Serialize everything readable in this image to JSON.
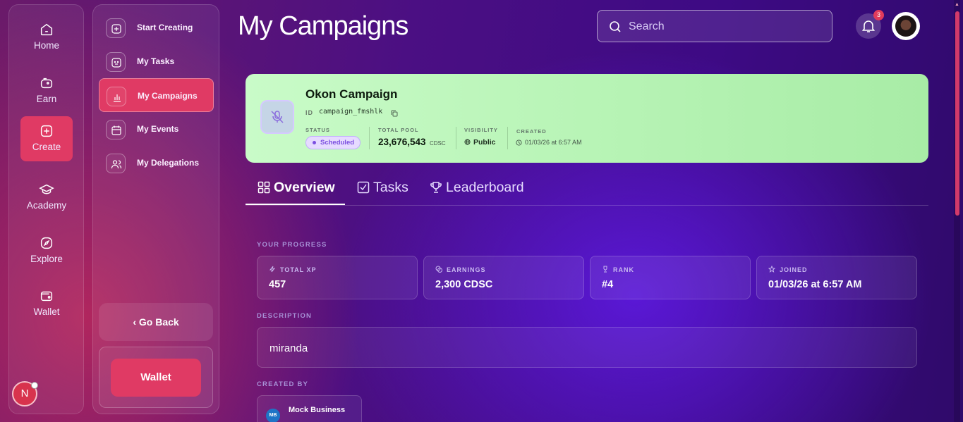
{
  "rail": {
    "items": [
      {
        "label": "Home",
        "icon": "home-icon"
      },
      {
        "label": "Earn",
        "icon": "piggy-bank-icon"
      },
      {
        "label": "Create",
        "icon": "plus-square-icon",
        "active": true
      },
      {
        "label": "Academy",
        "icon": "graduation-cap-icon"
      },
      {
        "label": "Explore",
        "icon": "compass-icon"
      },
      {
        "label": "Wallet",
        "icon": "wallet-icon"
      }
    ],
    "avatar_initial": "N"
  },
  "subnav": {
    "items": [
      {
        "label": "Start Creating",
        "icon": "plus-square-icon"
      },
      {
        "label": "My Tasks",
        "icon": "smiley-square-icon"
      },
      {
        "label": "My Campaigns",
        "icon": "bar-chart-icon",
        "active": true
      },
      {
        "label": "My Events",
        "icon": "calendar-icon"
      },
      {
        "label": "My Delegations",
        "icon": "users-icon"
      }
    ],
    "go_back": "Go Back",
    "wallet_button": "Wallet"
  },
  "header": {
    "title": "My Campaigns",
    "search_placeholder": "Search",
    "notification_count": "3"
  },
  "campaign": {
    "name": "Okon Campaign",
    "id_label": "ID",
    "id": "campaign_fmshlk",
    "status_label": "STATUS",
    "status": "Scheduled",
    "pool_label": "TOTAL POOL",
    "pool_value": "23,676,543",
    "pool_unit": "CDSC",
    "visibility_label": "VISIBILITY",
    "visibility": "Public",
    "created_label": "CREATED",
    "created": "01/03/26 at 6:57 AM"
  },
  "tabs": [
    {
      "label": "Overview",
      "active": true
    },
    {
      "label": "Tasks"
    },
    {
      "label": "Leaderboard"
    }
  ],
  "overview": {
    "progress_label": "YOUR PROGRESS",
    "stats": [
      {
        "label": "TOTAL XP",
        "value": "457"
      },
      {
        "label": "EARNINGS",
        "value": "2,300 CDSC"
      },
      {
        "label": "RANK",
        "value": "#4"
      },
      {
        "label": "JOINED",
        "value": "01/03/26 at 6:57 AM"
      }
    ],
    "description_label": "DESCRIPTION",
    "description": "miranda",
    "created_by_label": "CREATED BY",
    "creator_initials": "MB",
    "creator_name": "Mock Business"
  },
  "colors": {
    "accent": "#e03a64",
    "campaign_card": "#b8f4b6",
    "status_pill": "#7b4fe0"
  }
}
